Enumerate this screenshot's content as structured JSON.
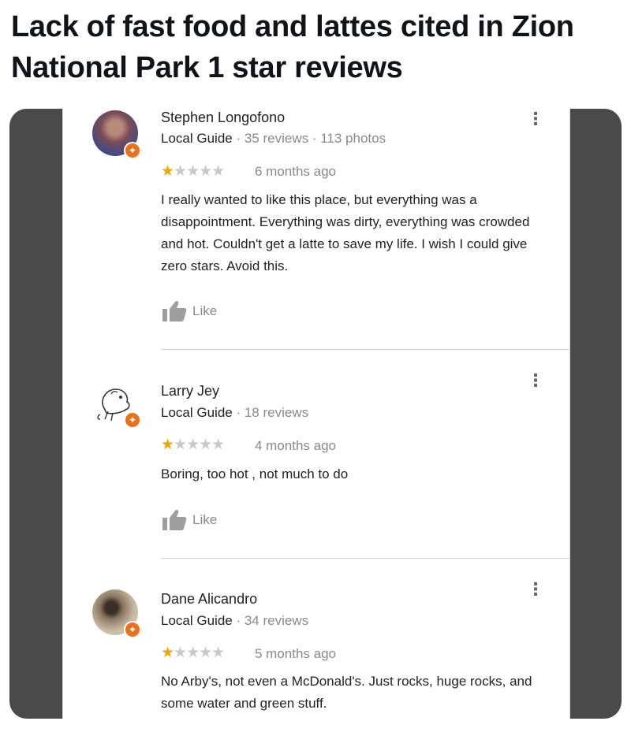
{
  "post": {
    "title": "Lack of fast food and lattes cited in Zion National Park 1 star reviews"
  },
  "reviews": [
    {
      "name": "Stephen Longofono",
      "badge": "Local Guide",
      "stats": " · 35 reviews · 113 photos",
      "rating": 1,
      "stars_on": "★",
      "stars_off": "★★★★",
      "time": "6 months ago",
      "text": "I really wanted to like this place, but everything was a disappointment.  Everything was dirty, everything was crowded and hot.  Couldn't get a latte to save my life.  I wish I could give zero stars.  Avoid this.",
      "like_label": "Like"
    },
    {
      "name": "Larry Jey",
      "badge": "Local Guide",
      "stats": " · 18 reviews",
      "rating": 1,
      "stars_on": "★",
      "stars_off": "★★★★",
      "time": "4 months ago",
      "text": "Boring,  too hot , not much to do",
      "like_label": "Like"
    },
    {
      "name": "Dane Alicandro",
      "badge": "Local Guide",
      "stats": " · 34 reviews",
      "rating": 1,
      "stars_on": "★",
      "stars_off": "★★★★",
      "time": "5 months ago",
      "text": "No Arby's, not even a McDonald's. Just rocks, huge rocks, and some water and green stuff.",
      "like_label": "Like"
    }
  ],
  "icons": {
    "more": "more-vertical-icon",
    "like": "thumbs-up-icon",
    "guide": "local-guide-badge-icon"
  },
  "colors": {
    "star_on": "#f2a700",
    "star_off": "#c8c8c8",
    "guide_badge": "#e8711a",
    "frame": "#4a4a4a"
  }
}
